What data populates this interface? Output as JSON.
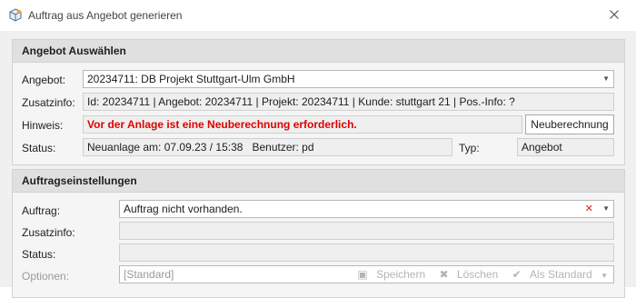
{
  "window": {
    "title": "Auftrag aus Angebot generieren",
    "icon": "package-icon",
    "close_icon": "close-icon"
  },
  "offer_group": {
    "header": "Angebot Auswählen",
    "angebot_label": "Angebot:",
    "angebot_value": "20234711: DB Projekt Stuttgart-Ulm GmbH",
    "zusatzinfo_label": "Zusatzinfo:",
    "zusatzinfo_value": "Id: 20234711 | Angebot: 20234711 | Projekt: 20234711 | Kunde: stuttgart 21 | Pos.-Info: ?",
    "hinweis_label": "Hinweis:",
    "hinweis_value": "Vor der Anlage ist eine Neuberechnung erforderlich.",
    "recalc_button": "Neuberechnung",
    "status_label": "Status:",
    "status_value": "Neuanlage am: 07.09.23 / 15:38   Benutzer: pd",
    "typ_label": "Typ:",
    "typ_value": "Angebot"
  },
  "order_group": {
    "header": "Auftragseinstellungen",
    "auftrag_label": "Auftrag:",
    "auftrag_value": "Auftrag nicht vorhanden.",
    "zusatzinfo_label": "Zusatzinfo:",
    "zusatzinfo_value": "",
    "status_label": "Status:",
    "status_value": "",
    "optionen_label": "Optionen:",
    "optionen_placeholder": "[Standard]",
    "save_label": "Speichern",
    "delete_label": "Löschen",
    "default_label": "Als Standard"
  },
  "colors": {
    "warning": "#e00000",
    "clear": "#d22222"
  }
}
